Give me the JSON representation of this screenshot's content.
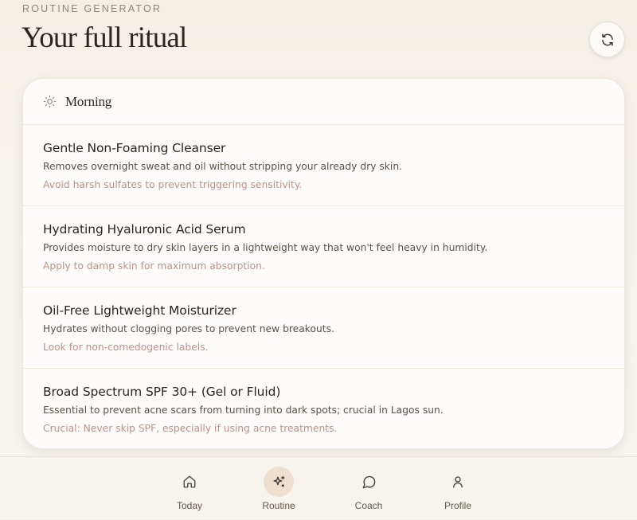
{
  "header": {
    "eyebrow": "ROUTINE GENERATOR",
    "title": "Your full ritual",
    "refresh_icon": "refresh-icon"
  },
  "routine": {
    "section_title": "Morning",
    "section_icon": "sun-icon",
    "steps": [
      {
        "name": "Gentle Non-Foaming Cleanser",
        "description": "Removes overnight sweat and oil without stripping your already dry skin.",
        "tip": "Avoid harsh sulfates to prevent triggering sensitivity."
      },
      {
        "name": "Hydrating Hyaluronic Acid Serum",
        "description": "Provides moisture to dry skin layers in a lightweight way that won't feel heavy in humidity.",
        "tip": "Apply to damp skin for maximum absorption."
      },
      {
        "name": "Oil-Free Lightweight Moisturizer",
        "description": "Hydrates without clogging pores to prevent new breakouts.",
        "tip": "Look for non-comedogenic labels."
      },
      {
        "name": "Broad Spectrum SPF 30+ (Gel or Fluid)",
        "description": "Essential to prevent acne scars from turning into dark spots; crucial in Lagos sun.",
        "tip": "Crucial: Never skip SPF, especially if using acne treatments."
      }
    ]
  },
  "nav": {
    "active": "Routine",
    "items": [
      {
        "label": "Today",
        "icon": "home-icon"
      },
      {
        "label": "Routine",
        "icon": "sparkle-icon"
      },
      {
        "label": "Coach",
        "icon": "chat-bubble-icon"
      },
      {
        "label": "Profile",
        "icon": "user-icon"
      }
    ]
  },
  "colors": {
    "accent_tip": "#c09088",
    "active_nav_bg": "#efdfcf",
    "background": "#f7f4ee"
  }
}
